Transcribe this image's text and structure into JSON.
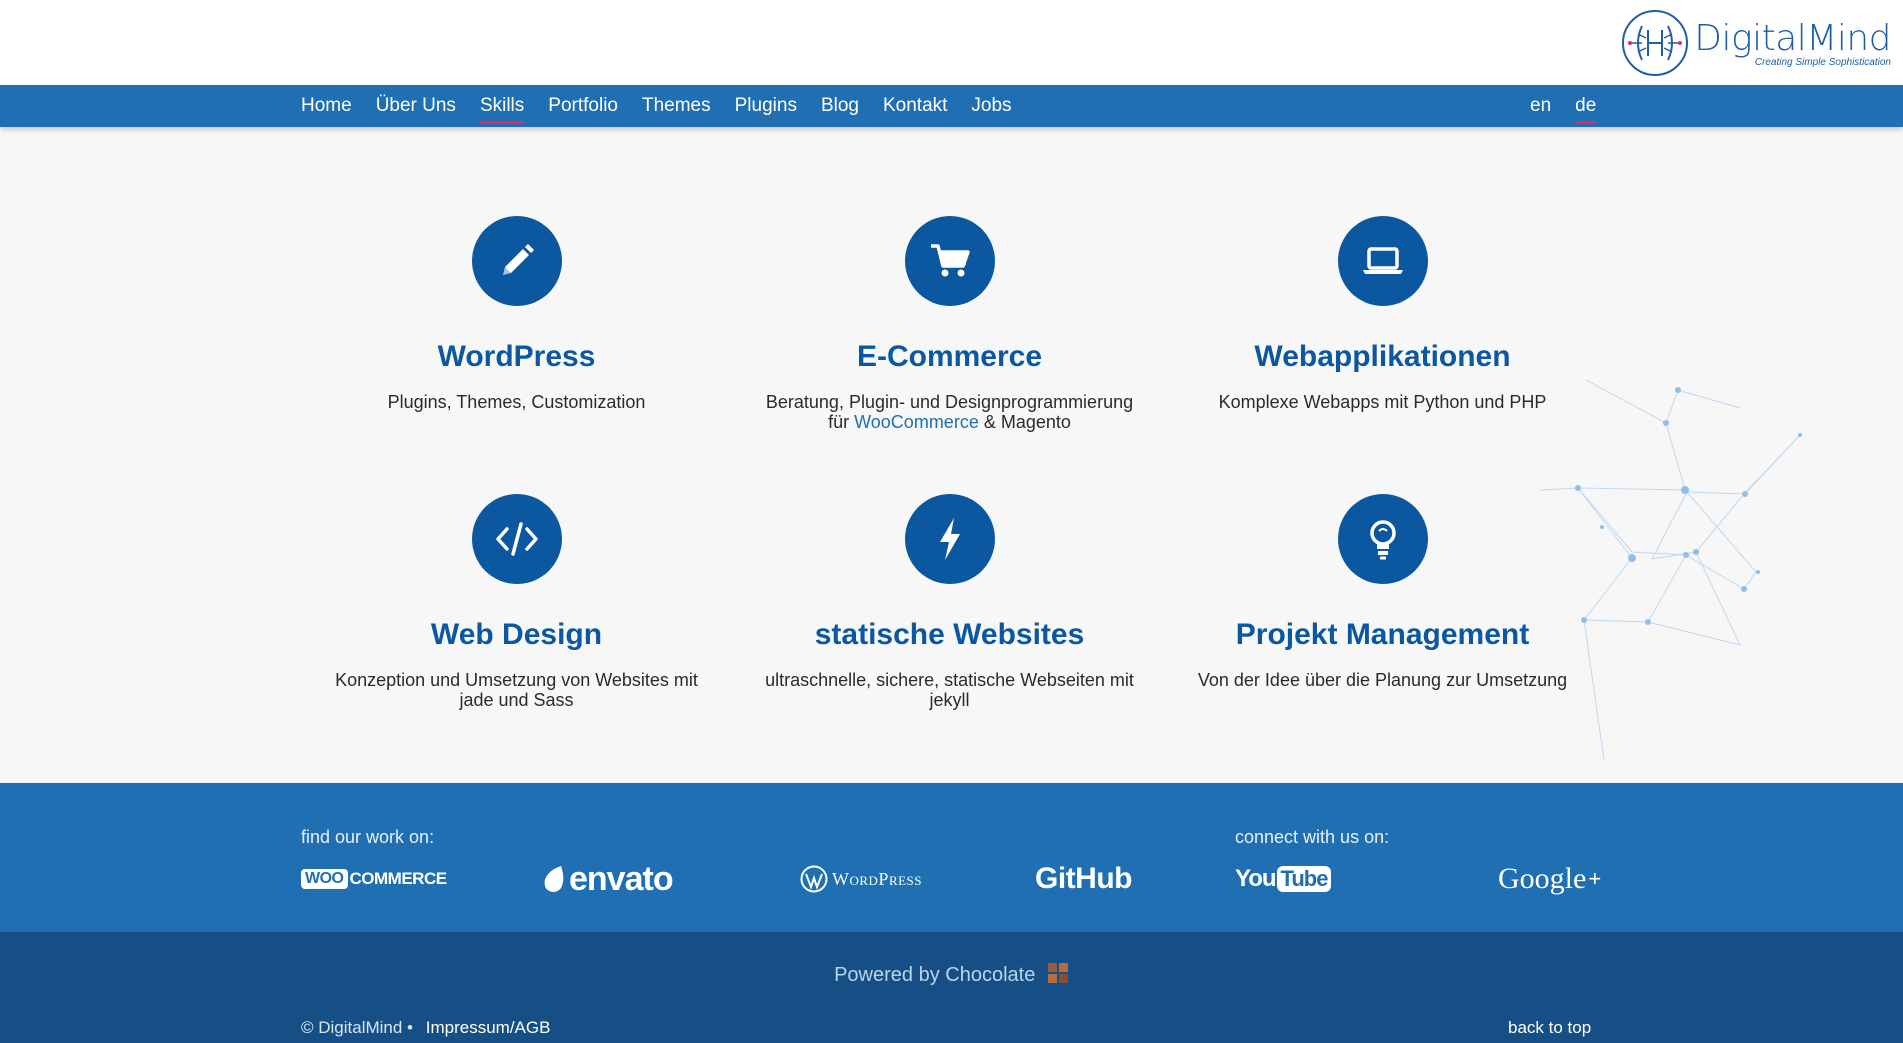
{
  "brand": {
    "name": "DigitalMind",
    "tagline": "Creating Simple Sophistication",
    "accent": "#1f6fb2",
    "dark": "#0b57a0",
    "highlight": "#e8285c"
  },
  "nav": {
    "items": [
      {
        "label": "Home"
      },
      {
        "label": "Über Uns"
      },
      {
        "label": "Skills",
        "active": true
      },
      {
        "label": "Portfolio"
      },
      {
        "label": "Themes"
      },
      {
        "label": "Plugins"
      },
      {
        "label": "Blog"
      },
      {
        "label": "Kontakt"
      },
      {
        "label": "Jobs"
      }
    ],
    "languages": [
      {
        "label": "en"
      },
      {
        "label": "de",
        "active": true
      }
    ]
  },
  "skills": [
    {
      "icon": "pencil-icon",
      "title": "WordPress",
      "desc": "Plugins, Themes, Customization"
    },
    {
      "icon": "cart-icon",
      "title": "E-Commerce",
      "desc_before": "Beratung, Plugin- und Designprogrammierung für ",
      "desc_link": "WooCommerce",
      "desc_after": " & Magento"
    },
    {
      "icon": "laptop-icon",
      "title": "Webapplikationen",
      "desc": "Komplexe Webapps mit Python und PHP"
    },
    {
      "icon": "code-icon",
      "title": "Web Design",
      "desc": "Konzeption und Umsetzung von Websites mit jade und Sass"
    },
    {
      "icon": "bolt-icon",
      "title": "statische Websites",
      "desc": "ultraschnelle, sichere, statische Webseiten mit jekyll"
    },
    {
      "icon": "lightbulb-icon",
      "title": "Projekt Management",
      "desc": "Von der Idee über die Planung zur Umsetzung"
    }
  ],
  "partners": {
    "find_label": "find our work on:",
    "connect_label": "connect with us on:",
    "woo_badge": "WOO",
    "woo_text": "COMMERCE",
    "envato": "envato",
    "wordpress": "WordPress",
    "github": "GitHub",
    "youtube_you": "You",
    "youtube_tube": "Tube",
    "google": "Google",
    "google_plus": "+"
  },
  "footer": {
    "powered": "Powered by Chocolate",
    "copyright": "© DigitalMind •",
    "impressum": "Impressum/AGB",
    "back_to_top": "back to top"
  }
}
